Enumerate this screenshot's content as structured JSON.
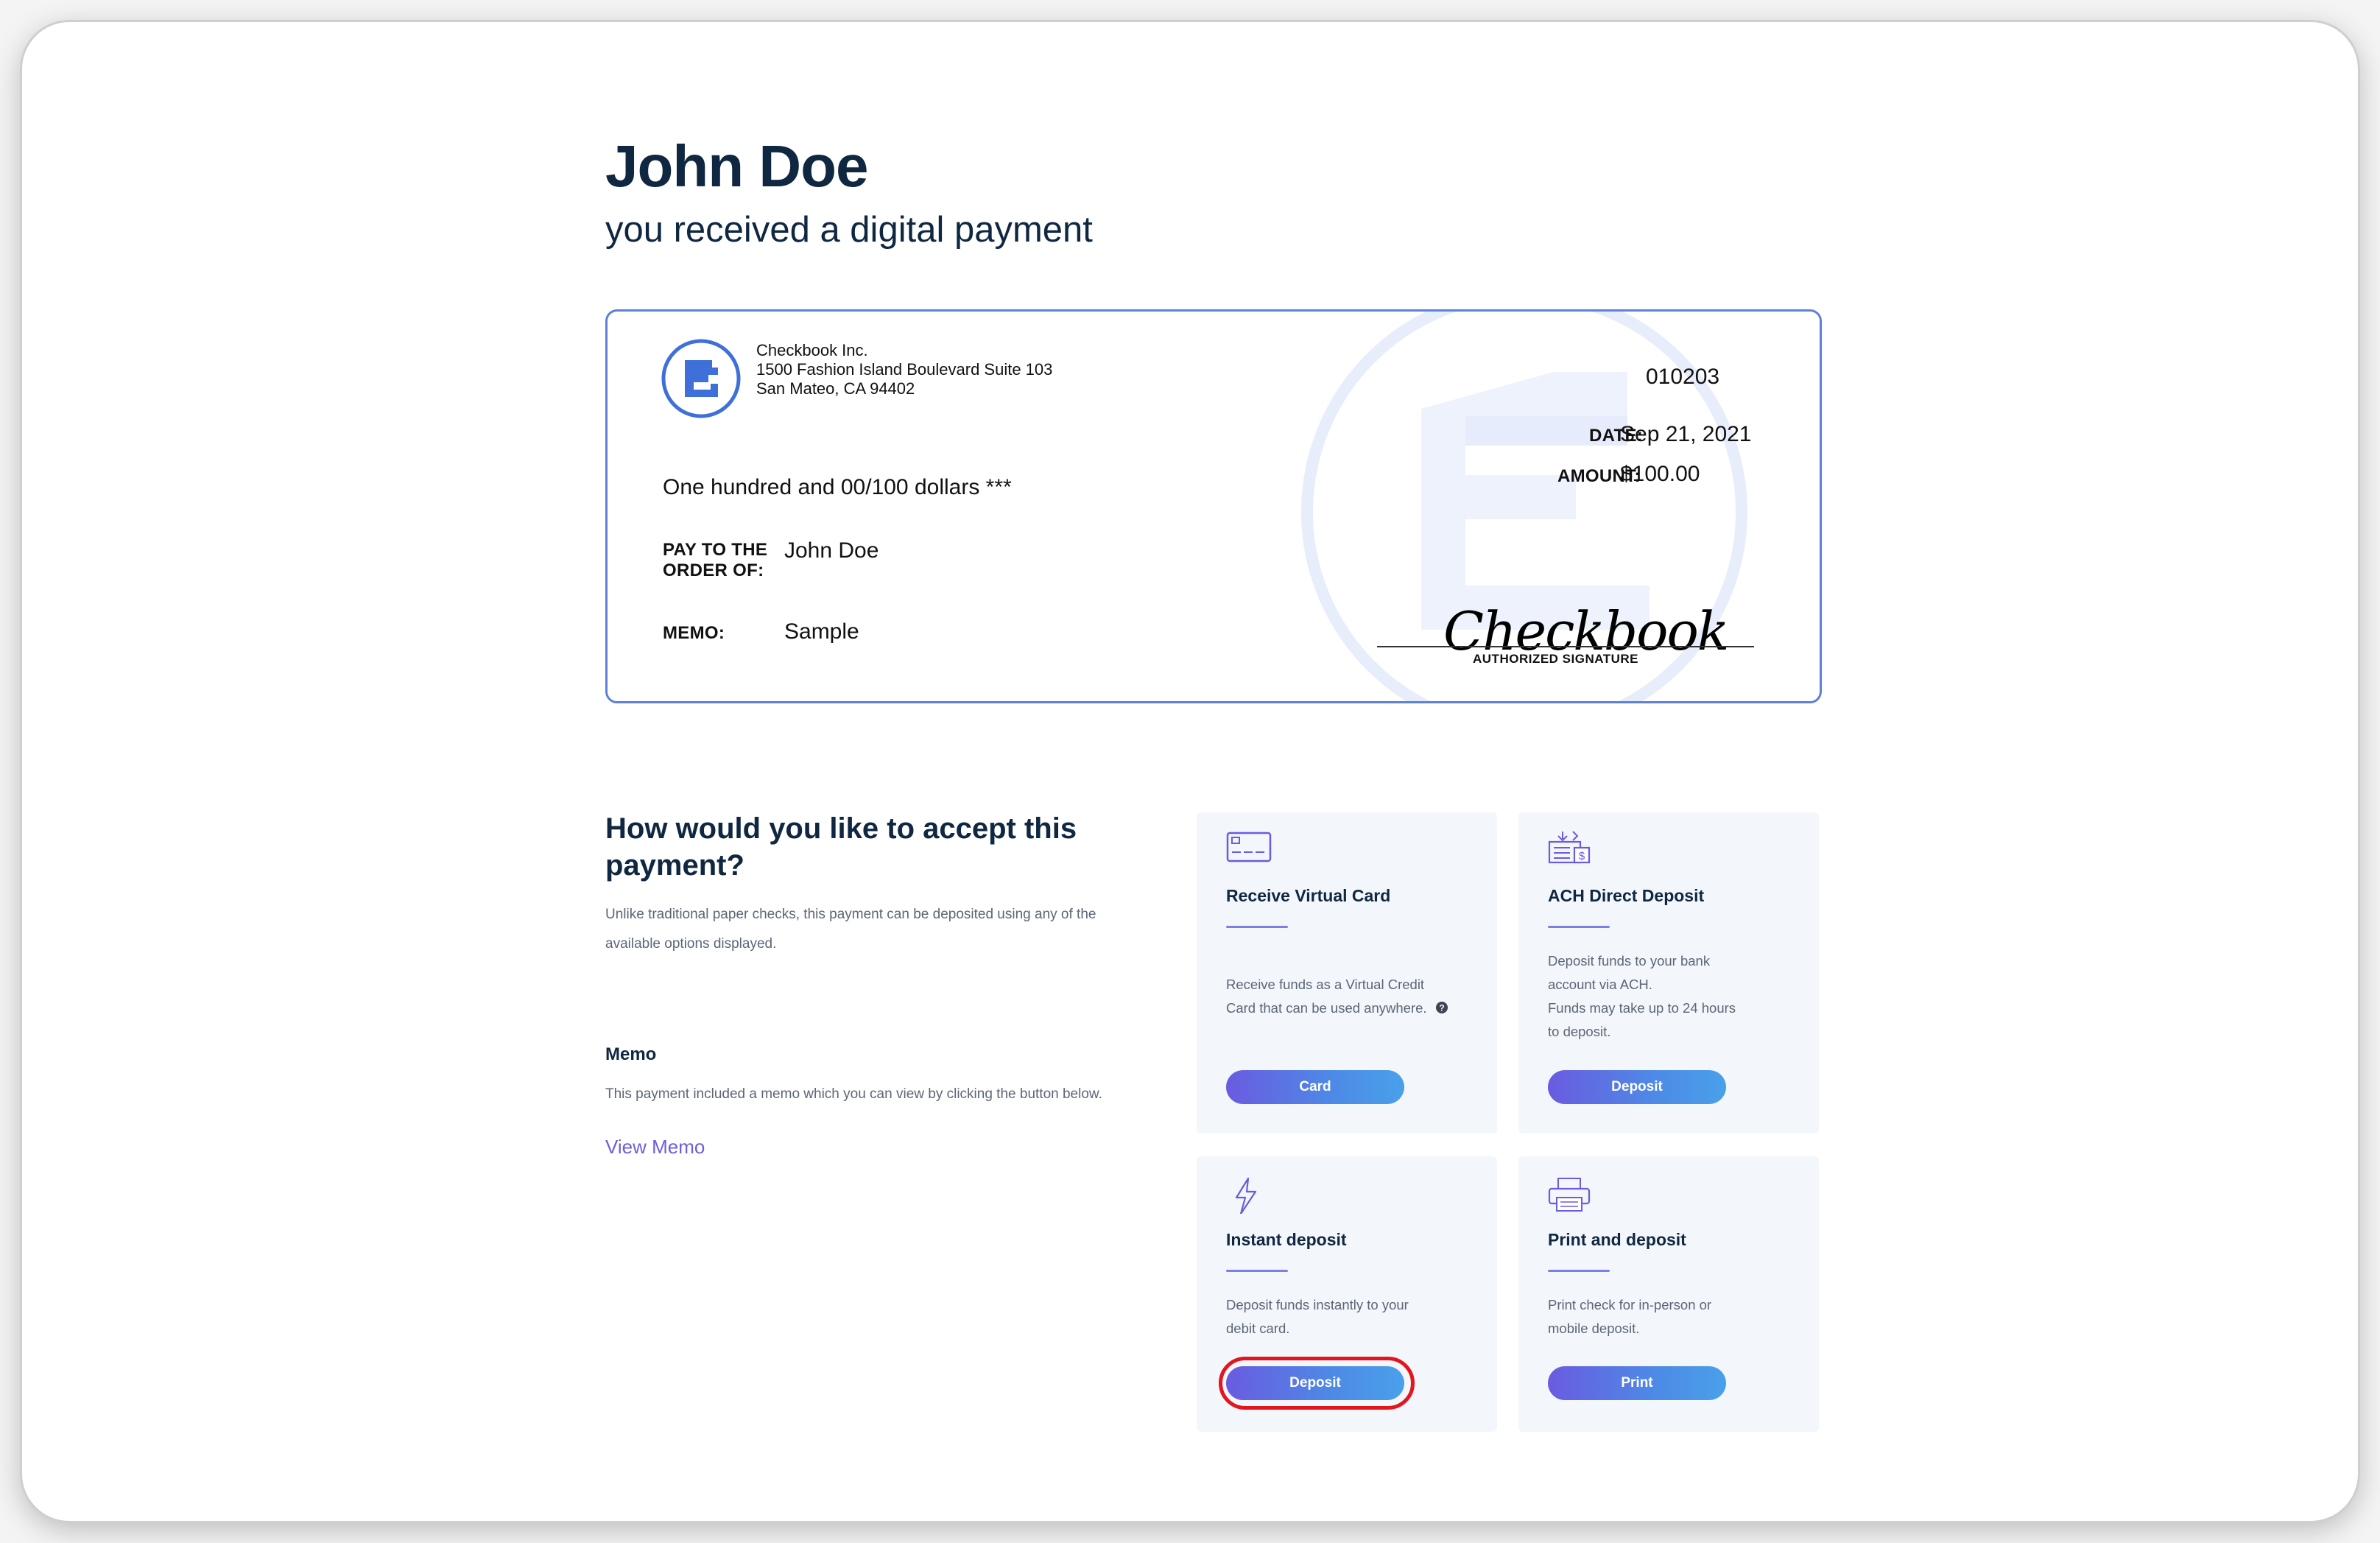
{
  "page": {
    "payee_name": "John Doe",
    "subtitle": "you received a digital payment"
  },
  "check": {
    "company_name": "Checkbook Inc.",
    "address_line1": "1500 Fashion Island Boulevard Suite 103",
    "address_line2": "San Mateo, CA 94402",
    "check_number": "010203",
    "date_label": "DATE:",
    "date": "Sep 21, 2021",
    "amount_label": "AMOUNT:",
    "amount": "$100.00",
    "amount_words": "One hundred and 00/100 dollars ***",
    "pay_to_label_line1": "PAY TO THE",
    "pay_to_label_line2": "ORDER OF:",
    "pay_to": "John Doe",
    "memo_label": "MEMO:",
    "memo": "Sample",
    "signature": "Checkbook",
    "signature_label": "AUTHORIZED SIGNATURE",
    "brand_color": "#3f6fd8"
  },
  "accept": {
    "heading": "How would you like to accept this payment?",
    "description_line1": "Unlike traditional paper checks, this payment can be deposited using any of the",
    "description_line2": "available options displayed."
  },
  "memo_section": {
    "heading": "Memo",
    "description": "This payment included a memo which you can view by clicking the button below.",
    "link": "View Memo"
  },
  "options": [
    {
      "icon": "credit-card-icon",
      "title": "Receive Virtual Card",
      "desc_line1": "Receive funds as a Virtual Credit",
      "desc_line2": "Card that can be used anywhere.",
      "help_icon": "question-circle-icon",
      "button": "Card"
    },
    {
      "icon": "bank-deposit-icon",
      "title": "ACH Direct Deposit",
      "desc_line1": "Deposit funds to your bank",
      "desc_line2": "account via ACH.",
      "desc_line3": "Funds may take up to 24 hours",
      "desc_line4": "to deposit.",
      "button": "Deposit"
    },
    {
      "icon": "lightning-bolt-icon",
      "title": "Instant deposit",
      "desc_line1": "Deposit funds instantly to your",
      "desc_line2": "debit card.",
      "button": "Deposit"
    },
    {
      "icon": "printer-icon",
      "title": "Print and deposit",
      "desc_line1": "Print check for in-person or",
      "desc_line2": "mobile deposit.",
      "button": "Print"
    }
  ],
  "colors": {
    "heading": "#0f2741",
    "accent": "#6a5be0",
    "button_gradient_end": "#49a0ea",
    "highlight": "#e3161f",
    "card_bg": "#f3f6fa"
  }
}
